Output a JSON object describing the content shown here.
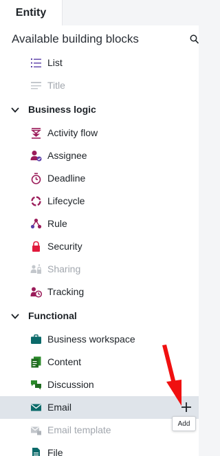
{
  "tab": {
    "label": "Entity"
  },
  "section": {
    "title": "Available building blocks"
  },
  "items_top": [
    {
      "label": "List",
      "icon": "list-icon",
      "disabled": false
    },
    {
      "label": "Title",
      "icon": "title-icon",
      "disabled": true
    }
  ],
  "groups": [
    {
      "label": "Business logic",
      "items": [
        {
          "label": "Activity flow",
          "icon": "activity-flow-icon",
          "disabled": false
        },
        {
          "label": "Assignee",
          "icon": "assignee-icon",
          "disabled": false
        },
        {
          "label": "Deadline",
          "icon": "deadline-icon",
          "disabled": false
        },
        {
          "label": "Lifecycle",
          "icon": "lifecycle-icon",
          "disabled": false
        },
        {
          "label": "Rule",
          "icon": "rule-icon",
          "disabled": false
        },
        {
          "label": "Security",
          "icon": "security-icon",
          "disabled": false
        },
        {
          "label": "Sharing",
          "icon": "sharing-icon",
          "disabled": true
        },
        {
          "label": "Tracking",
          "icon": "tracking-icon",
          "disabled": false
        }
      ]
    },
    {
      "label": "Functional",
      "items": [
        {
          "label": "Business workspace",
          "icon": "business-workspace-icon",
          "disabled": false
        },
        {
          "label": "Content",
          "icon": "content-icon",
          "disabled": false
        },
        {
          "label": "Discussion",
          "icon": "discussion-icon",
          "disabled": false
        },
        {
          "label": "Email",
          "icon": "email-icon",
          "disabled": false,
          "selected": true
        },
        {
          "label": "Email template",
          "icon": "email-template-icon",
          "disabled": true
        },
        {
          "label": "File",
          "icon": "file-icon",
          "disabled": false
        }
      ]
    }
  ],
  "tooltip": {
    "text": "Add"
  },
  "colors": {
    "purple": "#5b3fa8",
    "magenta": "#9b1c5a",
    "teal": "#0b6a6a",
    "green": "#2b8a2b",
    "red": "#e11a3c",
    "gray": "#a2a7ae",
    "selected_bg": "#dfe4ea"
  }
}
